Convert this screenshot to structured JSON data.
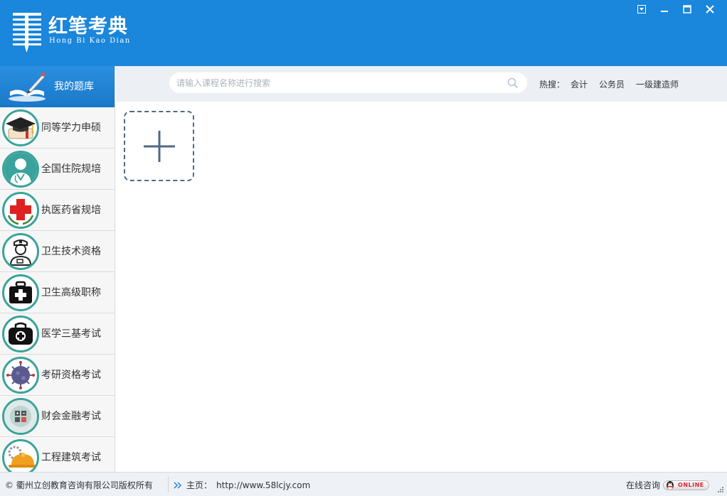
{
  "header": {
    "logo_cn": "红笔考典",
    "logo_en": "Hong Bi Kao Dian",
    "controls": [
      "menu-icon",
      "minimize-icon",
      "maximize-icon",
      "close-icon"
    ]
  },
  "sidebar": {
    "title": "我的题库",
    "items": [
      {
        "label": "同等学力申硕",
        "icon": "graduation-cap-icon"
      },
      {
        "label": "全国住院规培",
        "icon": "doctor-icon"
      },
      {
        "label": "执医药省规培",
        "icon": "red-cross-icon"
      },
      {
        "label": "卫生技术资格",
        "icon": "nurse-icon"
      },
      {
        "label": "卫生高级职称",
        "icon": "medical-kit-icon"
      },
      {
        "label": "医学三基考试",
        "icon": "medical-bag-icon"
      },
      {
        "label": "考研资格考试",
        "icon": "virus-icon"
      },
      {
        "label": "财会金融考试",
        "icon": "calculator-icon"
      },
      {
        "label": "工程建筑考试",
        "icon": "hard-hat-icon"
      }
    ]
  },
  "search": {
    "placeholder": "请输入课程名称进行搜索",
    "value": "",
    "hot_label": "热搜：",
    "hot_keywords": [
      "会计",
      "公务员",
      "一级建造师"
    ]
  },
  "footer": {
    "copyright": "© 衢州立创教育咨询有限公司版权所有",
    "home_label": "主页：",
    "home_url": "http://www.58lcjy.com",
    "consult_label": "在线咨询",
    "online_badge": "ONLINE"
  },
  "colors": {
    "header_bg": "#1a86dc",
    "ring": "#3aa39b",
    "topbar_bg": "#ecf0f5",
    "add_tile_border": "#4e6a85"
  }
}
